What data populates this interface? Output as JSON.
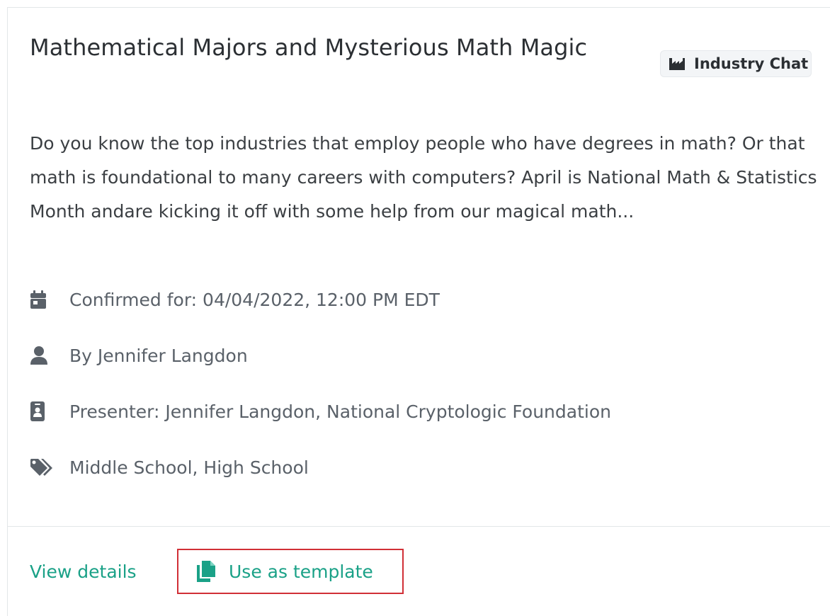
{
  "card": {
    "title": "Mathematical Majors and Mysterious Math Magic",
    "badge": {
      "label": "Industry Chat",
      "icon": "industry-icon"
    },
    "description": "Do you know the top industries that employ people who have degrees in math? Or that math is foundational to many careers with computers? April is National Math & Statistics Month andare kicking it off with some help from our magical math...",
    "meta": {
      "date": {
        "icon": "calendar-icon",
        "text": "Confirmed for: 04/04/2022, 12:00 PM EDT"
      },
      "author": {
        "icon": "user-icon",
        "text": "By Jennifer Langdon"
      },
      "presenter": {
        "icon": "id-badge-icon",
        "text": "Presenter: Jennifer Langdon, National Cryptologic Foundation"
      },
      "tags": {
        "icon": "tags-icon",
        "text": "Middle School, High School"
      }
    },
    "footer": {
      "view_details": "View details",
      "use_template": "Use as template",
      "use_template_icon": "copy-icon"
    }
  },
  "colors": {
    "accent": "#1aa187",
    "highlight_border": "#d12f36",
    "icon_gray": "#5a6169",
    "title": "#2b2f33"
  }
}
